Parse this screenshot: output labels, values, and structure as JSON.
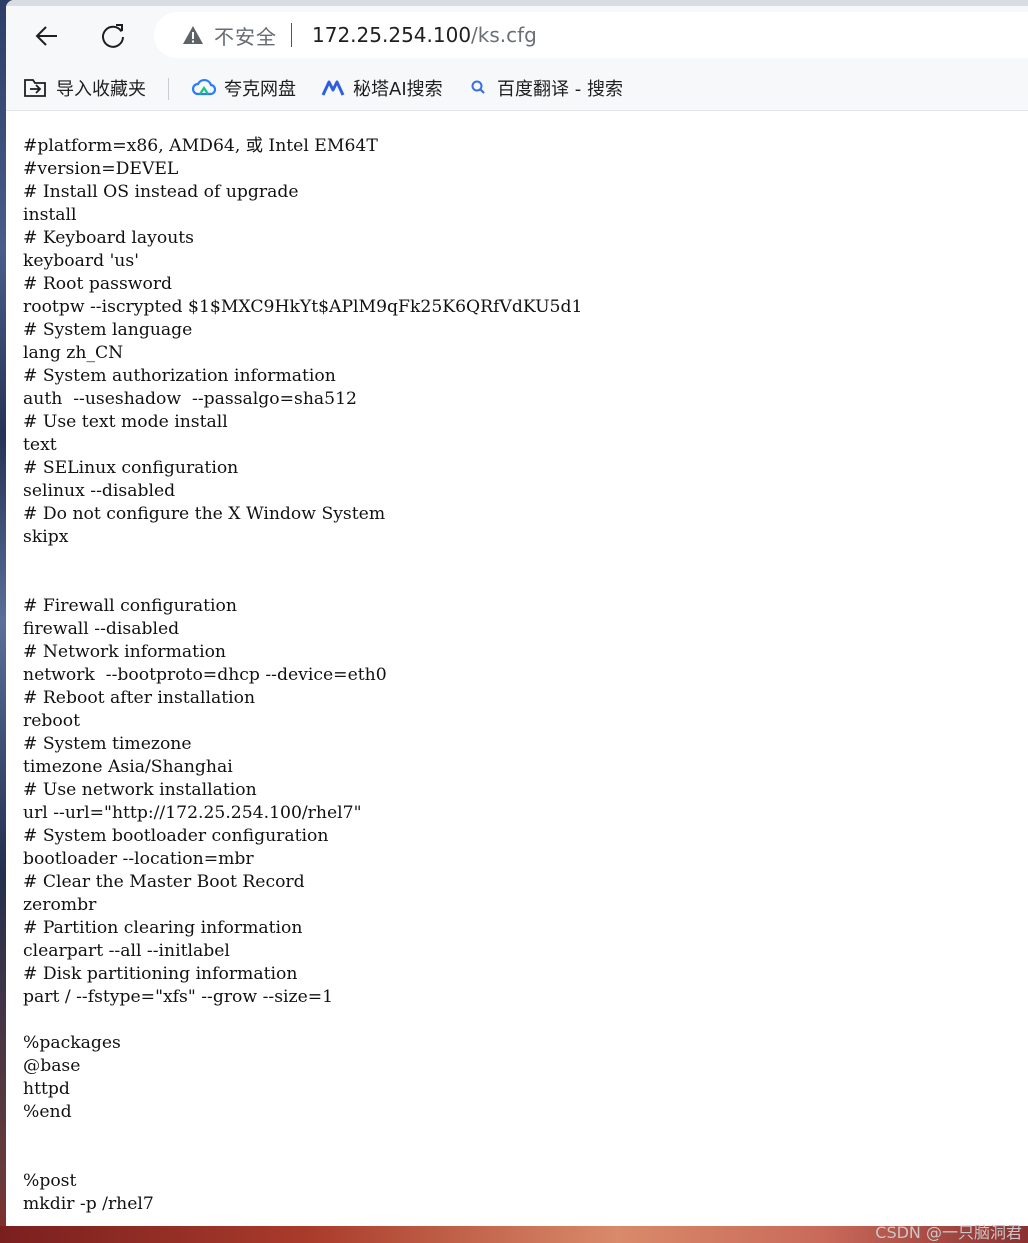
{
  "toolbar": {
    "back_icon": "arrow-left-icon",
    "reload_icon": "reload-icon",
    "security_icon": "warning-triangle-icon",
    "security_label": "不安全",
    "url_host": "172.25.254.100",
    "url_path": "/ks.cfg"
  },
  "bookmarks": [
    {
      "label": "导入收藏夹",
      "icon": "import-favorites-icon"
    },
    {
      "label": "夸克网盘",
      "icon": "quark-cloud-icon"
    },
    {
      "label": "秘塔AI搜索",
      "icon": "metaso-icon"
    },
    {
      "label": "百度翻译 - 搜索",
      "icon": "search-icon"
    }
  ],
  "file_lines": [
    "#platform=x86, AMD64, 或 Intel EM64T",
    "#version=DEVEL",
    "# Install OS instead of upgrade",
    "install",
    "# Keyboard layouts",
    "keyboard 'us'",
    "# Root password",
    "rootpw --iscrypted $1$MXC9HkYt$APlM9qFk25K6QRfVdKU5d1",
    "# System language",
    "lang zh_CN",
    "# System authorization information",
    "auth  --useshadow  --passalgo=sha512",
    "# Use text mode install",
    "text",
    "# SELinux configuration",
    "selinux --disabled",
    "# Do not configure the X Window System",
    "skipx",
    "",
    "",
    "# Firewall configuration",
    "firewall --disabled",
    "# Network information",
    "network  --bootproto=dhcp --device=eth0",
    "# Reboot after installation",
    "reboot",
    "# System timezone",
    "timezone Asia/Shanghai",
    "# Use network installation",
    "url --url=\"http://172.25.254.100/rhel7\"",
    "# System bootloader configuration",
    "bootloader --location=mbr",
    "# Clear the Master Boot Record",
    "zerombr",
    "# Partition clearing information",
    "clearpart --all --initlabel",
    "# Disk partitioning information",
    "part / --fstype=\"xfs\" --grow --size=1",
    "",
    "%packages",
    "@base",
    "httpd",
    "%end",
    "",
    "",
    "%post",
    "mkdir -p /rhel7"
  ],
  "watermark": "CSDN @一只脑洞君"
}
